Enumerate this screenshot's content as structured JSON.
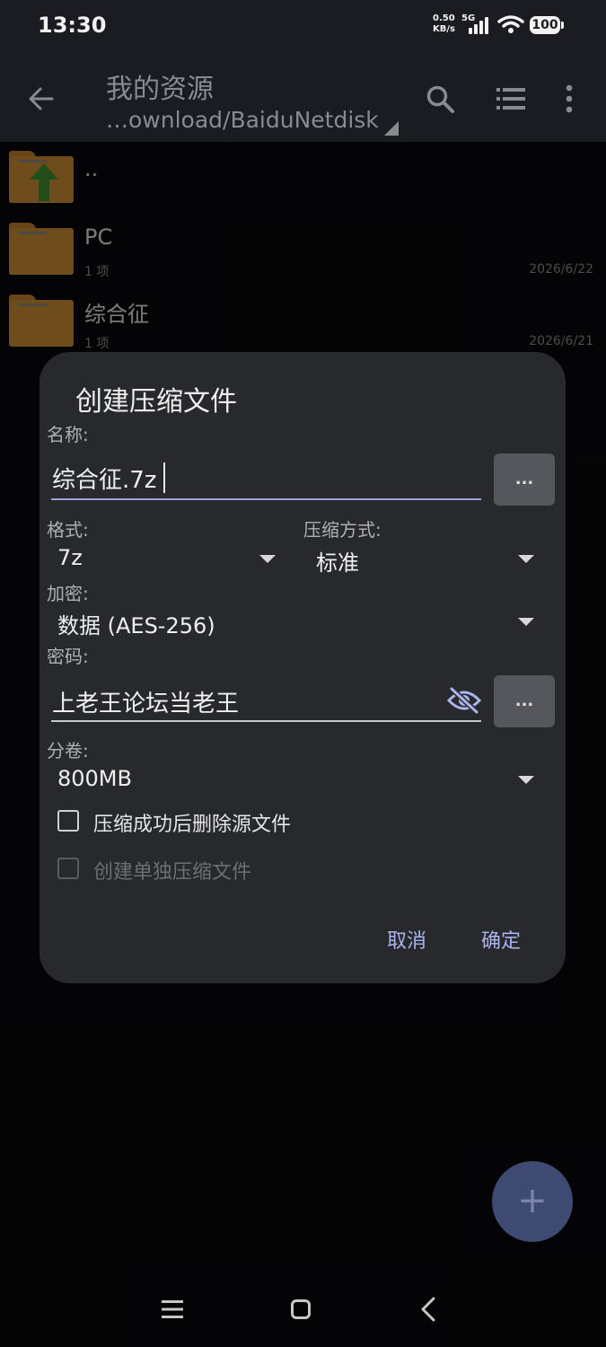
{
  "status_bar": {
    "time": "13:30",
    "net_speed_value": "0.50",
    "net_speed_unit": "KB/s",
    "network_type": "5G",
    "battery": "100"
  },
  "app_bar": {
    "title": "我的资源",
    "path": "…ownload/BaiduNetdisk"
  },
  "files": [
    {
      "name": "..",
      "sub": "",
      "date": ""
    },
    {
      "name": "PC",
      "sub": "1 项",
      "date": "2026/6/22"
    },
    {
      "name": "综合征",
      "sub": "1 项",
      "date": "2026/6/21"
    }
  ],
  "dialog": {
    "title": "创建压缩文件",
    "name_label": "名称:",
    "name_value": "综合征.7z",
    "browse_label": "...",
    "format_label": "格式:",
    "format_value": "7z",
    "method_label": "压缩方式:",
    "method_value": "标准",
    "encryption_label": "加密:",
    "encryption_value": "数据 (AES-256)",
    "password_label": "密码:",
    "password_value": "上老王论坛当老王",
    "volume_label": "分卷:",
    "volume_value": "800MB",
    "checkbox_delete": {
      "label": "压缩成功后删除源文件",
      "checked": false
    },
    "checkbox_separate": {
      "label": "创建单独压缩文件",
      "checked": false,
      "disabled": true
    },
    "cancel_label": "取消",
    "ok_label": "确定"
  },
  "colors": {
    "accent": "#aab4ec",
    "dialog_bg": "#27292d",
    "folder": "#c88a34",
    "fab": "#3f4a72"
  },
  "icons": [
    "back-arrow-icon",
    "search-icon",
    "list-view-icon",
    "more-vert-icon",
    "folder-up-icon",
    "folder-icon",
    "eye-off-icon",
    "plus-icon",
    "nav-menu-icon",
    "nav-home-icon",
    "nav-back-icon"
  ]
}
